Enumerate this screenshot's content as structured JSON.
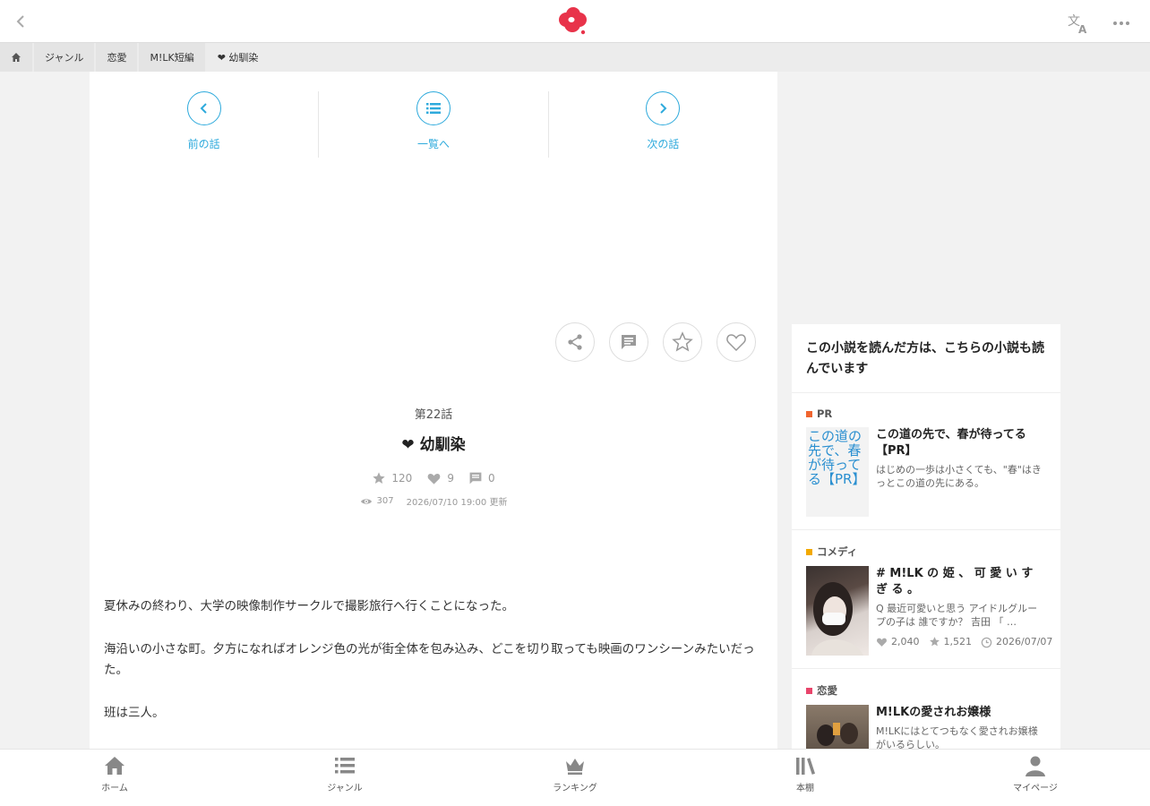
{
  "header": {
    "back_icon": "chevron-left-icon",
    "logo_icon": "cloud-logo",
    "translate_icon": "translate-icon",
    "more_icon": "more-dots-icon"
  },
  "breadcrumb": {
    "home_icon": "home-icon",
    "items": [
      {
        "label": "ジャンル"
      },
      {
        "label": "恋愛"
      },
      {
        "label": "M!LK短編"
      },
      {
        "label": "❤︎ 幼馴染"
      }
    ]
  },
  "episode_nav": {
    "prev": "前の話",
    "list": "一覧へ",
    "next": "次の話"
  },
  "episode": {
    "number": "第22話",
    "title": "❤︎ 幼馴染",
    "stars": "120",
    "likes": "9",
    "comments": "0",
    "views": "307",
    "updated": "2026/07/10 19:00 更新"
  },
  "body": {
    "paragraphs": [
      "夏休みの終わり、大学の映像制作サークルで撮影旅行へ行くことになった。",
      "海沿いの小さな町。夕方になればオレンジ色の光が街全体を包み込み、どこを切り取っても映画のワンシーンみたいだった。",
      "班は三人。"
    ]
  },
  "sidebar": {
    "heading": "この小説を読んだ方は、こちらの小説も読んでいます",
    "items": [
      {
        "category": "PR",
        "category_color": "#f0652f",
        "thumb_alt": "この道の先で、春が待ってる【PR】",
        "title": "この道の先で、春が待ってる【PR】",
        "desc": "はじめの一歩は小さくても、\"春\"はきっとこの道の先にある。"
      },
      {
        "category": "コメディ",
        "category_color": "#f2a900",
        "title": "# M!LK の 姫 、 可 愛 い す ぎ る 。",
        "desc": "Q 最近可愛いと思う アイドルグループの子は 誰ですか？ 吉田 「 …",
        "likes": "2,040",
        "stars": "1,521",
        "date": "2026/07/07"
      },
      {
        "category": "恋愛",
        "category_color": "#e8456b",
        "title": "M!LKの愛されお嬢様",
        "desc": "M!LKにはとてつもなく愛されお嬢様がいるらしい。"
      }
    ]
  },
  "tabbar": {
    "home": "ホーム",
    "genre": "ジャンル",
    "ranking": "ランキング",
    "shelf": "本棚",
    "mypage": "マイページ"
  },
  "colors": {
    "accent": "#2eaadc",
    "logo": "#e8334a"
  }
}
